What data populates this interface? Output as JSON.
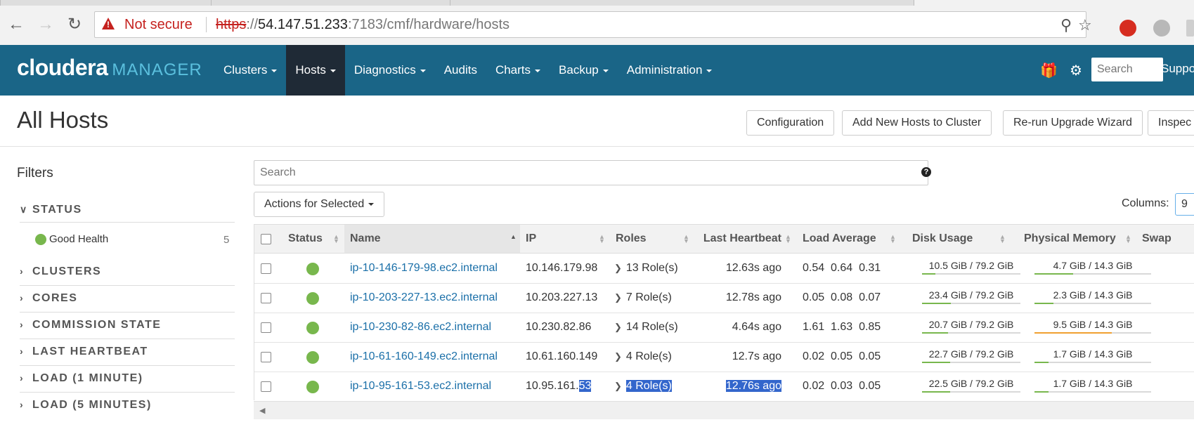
{
  "browser": {
    "not_secure": "Not secure",
    "url_scheme": "https",
    "url_sep": "://",
    "url_host": "54.147.51.233",
    "url_path": ":7183/cmf/hardware/hosts"
  },
  "header": {
    "logo_main": "cloudera",
    "logo_sub": "MANAGER",
    "nav": [
      {
        "label": "Clusters",
        "dropdown": true
      },
      {
        "label": "Hosts",
        "dropdown": true,
        "active": true
      },
      {
        "label": "Diagnostics",
        "dropdown": true
      },
      {
        "label": "Audits",
        "dropdown": false
      },
      {
        "label": "Charts",
        "dropdown": true
      },
      {
        "label": "Backup",
        "dropdown": true
      },
      {
        "label": "Administration",
        "dropdown": true
      }
    ],
    "search_placeholder": "Search",
    "support_label": "Suppo"
  },
  "page": {
    "title": "All Hosts",
    "buttons": {
      "configuration": "Configuration",
      "add_hosts": "Add New Hosts to Cluster",
      "rerun_wizard": "Re-run Upgrade Wizard",
      "inspect": "Inspec"
    }
  },
  "filters": {
    "title": "Filters",
    "status": {
      "heading": "STATUS",
      "good_health_label": "Good Health",
      "good_health_count": "5"
    },
    "groups": [
      "CLUSTERS",
      "CORES",
      "COMMISSION STATE",
      "LAST HEARTBEAT",
      "LOAD (1 MINUTE)",
      "LOAD (5 MINUTES)"
    ]
  },
  "table": {
    "search_placeholder": "Search",
    "actions_label": "Actions for Selected",
    "columns_label": "Columns:",
    "columns_value": "9",
    "headers": {
      "status": "Status",
      "name": "Name",
      "ip": "IP",
      "roles": "Roles",
      "last_heartbeat": "Last Heartbeat",
      "load_average": "Load Average",
      "disk_usage": "Disk Usage",
      "physical_memory": "Physical Memory",
      "swap": "Swap"
    },
    "rows": [
      {
        "name": "ip-10-146-179-98.ec2.internal",
        "ip": "10.146.179.98",
        "roles": "13 Role(s)",
        "heartbeat": "12.63s ago",
        "load": [
          "0.54",
          "0.64",
          "0.31"
        ],
        "disk": "10.5 GiB / 79.2 GiB",
        "disk_fraction": 0.133,
        "memory": "4.7 GiB / 14.3 GiB",
        "memory_fraction": 0.33,
        "memory_color": "#78b74d"
      },
      {
        "name": "ip-10-203-227-13.ec2.internal",
        "ip": "10.203.227.13",
        "roles": "7 Role(s)",
        "heartbeat": "12.78s ago",
        "load": [
          "0.05",
          "0.08",
          "0.07"
        ],
        "disk": "23.4 GiB / 79.2 GiB",
        "disk_fraction": 0.295,
        "memory": "2.3 GiB / 14.3 GiB",
        "memory_fraction": 0.16,
        "memory_color": "#78b74d"
      },
      {
        "name": "ip-10-230-82-86.ec2.internal",
        "ip": "10.230.82.86",
        "roles": "14 Role(s)",
        "heartbeat": "4.64s ago",
        "load": [
          "1.61",
          "1.63",
          "0.85"
        ],
        "disk": "20.7 GiB / 79.2 GiB",
        "disk_fraction": 0.261,
        "memory": "9.5 GiB / 14.3 GiB",
        "memory_fraction": 0.664,
        "memory_color": "#f0a030"
      },
      {
        "name": "ip-10-61-160-149.ec2.internal",
        "ip": "10.61.160.149",
        "roles": "4 Role(s)",
        "heartbeat": "12.7s ago",
        "load": [
          "0.02",
          "0.05",
          "0.05"
        ],
        "disk": "22.7 GiB / 79.2 GiB",
        "disk_fraction": 0.287,
        "memory": "1.7 GiB / 14.3 GiB",
        "memory_fraction": 0.119,
        "memory_color": "#78b74d"
      },
      {
        "name": "ip-10-95-161-53.ec2.internal",
        "ip_prefix": "10.95.161.",
        "ip_selected": "53",
        "roles": "4 Role(s)",
        "heartbeat": "12.76s ago",
        "load": [
          "0.02",
          "0.03",
          "0.05"
        ],
        "disk": "22.5 GiB / 79.2 GiB",
        "disk_fraction": 0.284,
        "memory": "1.7 GiB / 14.3 GiB",
        "memory_fraction": 0.119,
        "memory_color": "#78b74d",
        "selected_text": true
      }
    ]
  },
  "colors": {
    "header_bg": "#1a6587",
    "active_nav_bg": "#1f2a36",
    "good_health": "#78b74d",
    "link": "#1a6fa8",
    "warning": "#c5221f"
  }
}
